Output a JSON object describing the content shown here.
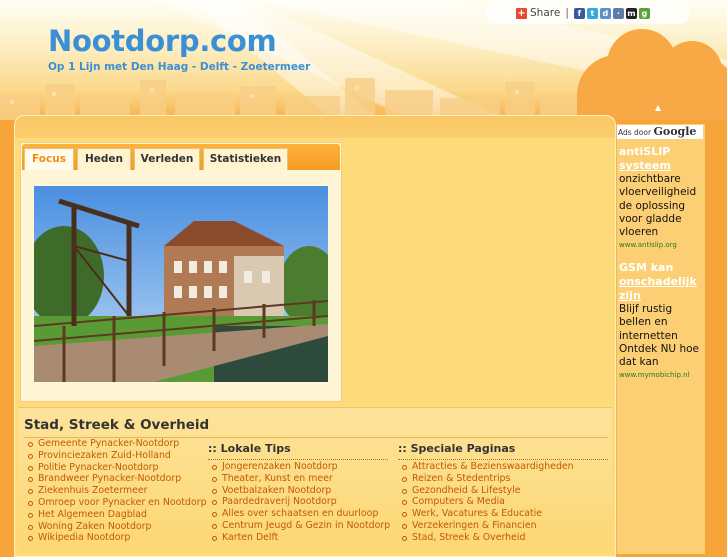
{
  "header": {
    "title": "Nootdorp.com",
    "subtitle": "Op 1 Lijn met Den Haag - Delft - Zoetermeer"
  },
  "share": {
    "label": "Share",
    "separator": "|",
    "icons": [
      "facebook-icon",
      "twitter-icon",
      "digg-icon",
      "delicious-icon",
      "myspace-icon",
      "google-bookmarks-icon"
    ]
  },
  "tabs": [
    {
      "label": "Focus",
      "active": true
    },
    {
      "label": "Heden",
      "active": false
    },
    {
      "label": "Verleden",
      "active": false
    },
    {
      "label": "Statistieken",
      "active": false
    }
  ],
  "section": {
    "title": "Stad, Streek & Overheid",
    "col1": [
      "Gemeente Pynacker-Nootdorp",
      "Provinciezaken Zuid-Holland",
      "Politie Pynacker-Nootdorp",
      "Brandweer Pynacker-Nootdorp",
      "Ziekenhuis Zoetermeer",
      "Omroep voor Pynacker en Nootdorp",
      "Het Algemeen Dagblad",
      "Woning Zaken Nootdorp",
      "Wikipedia Nootdorp"
    ],
    "col2_title": ":: Lokale Tips",
    "col2": [
      "Jongerenzaken Nootdorp",
      "Theater, Kunst en meer",
      "Voetbalzaken Nootdorp",
      "Paardedraverij Nootdorp",
      "Alles over schaatsen en duurloop",
      "Centrum Jeugd & Gezin in Nootdorp",
      "Karten Delft"
    ],
    "col3_title": ":: Speciale Paginas",
    "col3": [
      "Attracties & Bezienswaardigheden",
      "Reizen & Stedentrips",
      "Gezondheid & Lifestyle",
      "Computers & Media",
      "Werk, Vacatures & Educatie",
      "Verzekeringen & Financien",
      "Stad, Streek & Overheid"
    ]
  },
  "ads": {
    "label_prefix": "Ads door",
    "label_brand": "Google",
    "items": [
      {
        "title_line1": "antiSLIP",
        "title_line2": "systeem",
        "text": "onzichtbare vloerveiligheid de oplossing voor gladde vloeren",
        "url": "www.antislip.org"
      },
      {
        "title_line1": "GSM kan",
        "title_line2": "onschadelijk zijn",
        "text": "Blijf rustig bellen en internetten Ontdek NU hoe dat kan",
        "url": "www.mymobichip.nl"
      }
    ]
  },
  "colors": {
    "accent": "#3a8fd6",
    "link": "#c45a00",
    "orange": "#f7a43a"
  }
}
